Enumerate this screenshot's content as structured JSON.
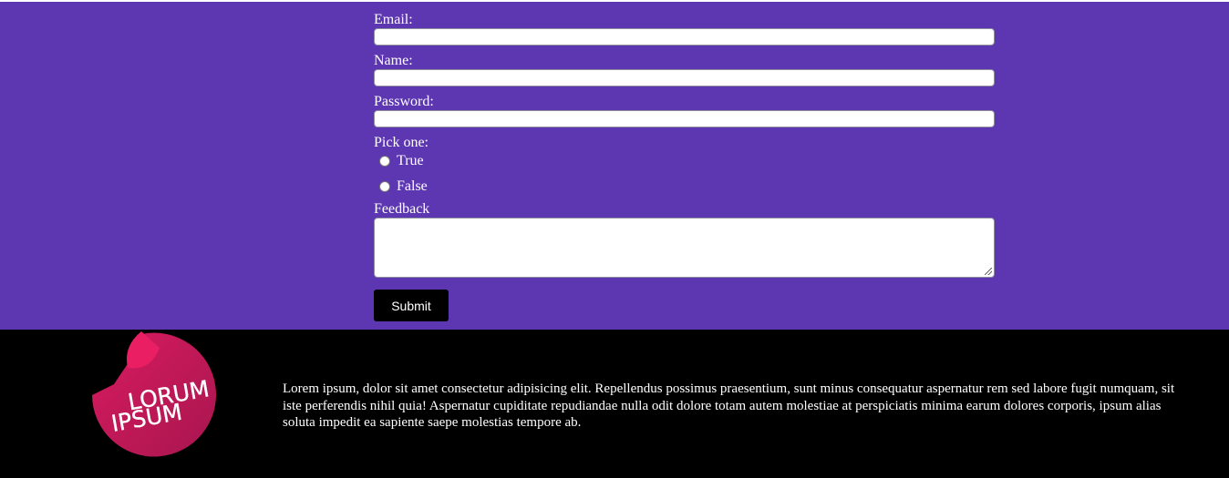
{
  "form": {
    "email_label": "Email:",
    "email_value": "",
    "name_label": "Name:",
    "name_value": "",
    "password_label": "Password:",
    "password_value": "",
    "pick_label": "Pick one:",
    "options": [
      "True",
      "False"
    ],
    "feedback_label": "Feedback",
    "feedback_value": "",
    "submit_label": "Submit"
  },
  "footer": {
    "logo_text_line1": "LORUM",
    "logo_text_line2": "IPSUM",
    "paragraph": "Lorem ipsum, dolor sit amet consectetur adipisicing elit. Repellendus possimus praesentium, sunt minus consequatur aspernatur rem sed labore fugit numquam, sit iste perferendis nihil quia! Aspernatur cupiditate repudiandae nulla odit dolore totam autem molestiae at perspiciatis minima earum dolores corporis, ipsum alias soluta impedit ea sapiente saepe molestias tempore ab."
  },
  "colors": {
    "form_background": "#5d36b2",
    "footer_background": "#000000",
    "logo_color": "#c2185b"
  }
}
